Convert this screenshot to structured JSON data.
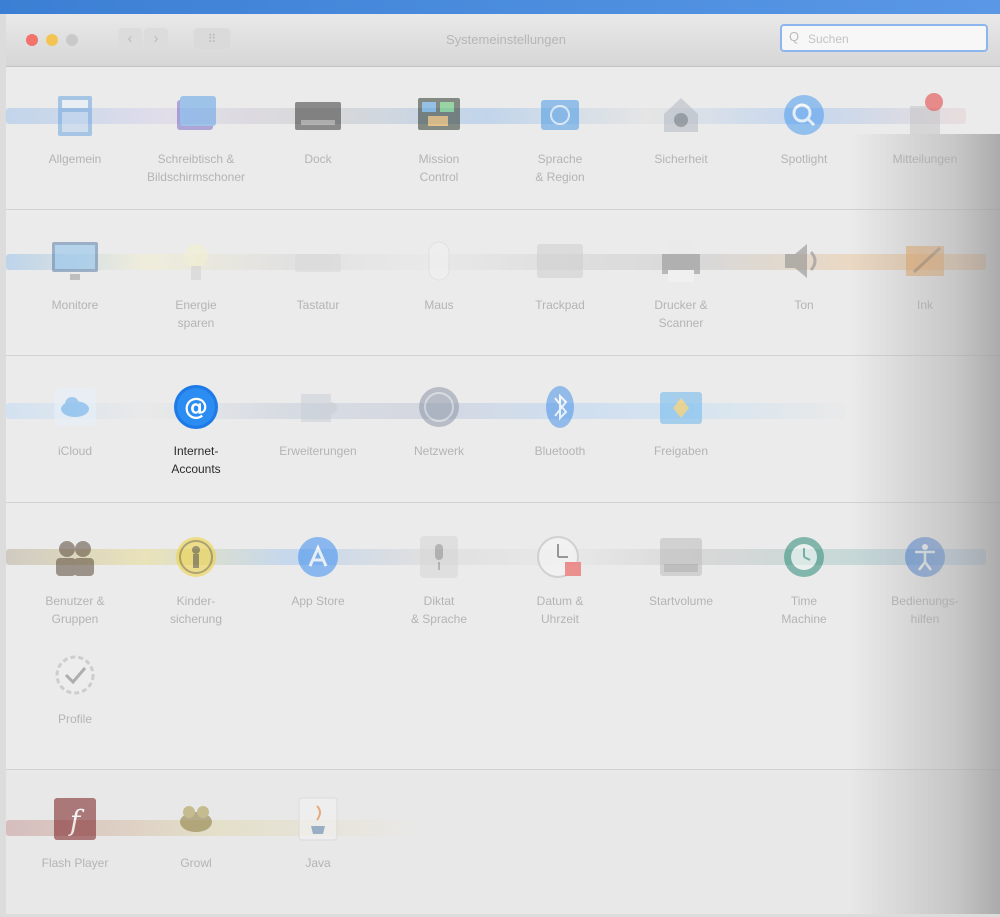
{
  "window": {
    "title": "Systemeinstellungen",
    "search_placeholder": "Suchen",
    "search_glyph": "Q",
    "nav_back_glyph": "‹",
    "nav_forward_glyph": "›",
    "grid_glyph": "⠿"
  },
  "rows": [
    {
      "items": [
        {
          "label": "Allgemein",
          "icon": "general-icon"
        },
        {
          "label": "Schreibtisch &\nBildschirmschoner",
          "icon": "desktop-screensaver-icon"
        },
        {
          "label": "Dock",
          "icon": "dock-icon"
        },
        {
          "label": "Mission\nControl",
          "icon": "mission-control-icon"
        },
        {
          "label": "Sprache\n& Region",
          "icon": "language-region-icon"
        },
        {
          "label": "Sicherheit",
          "icon": "security-icon"
        },
        {
          "label": "Spotlight",
          "icon": "spotlight-icon"
        },
        {
          "label": "Mitteilungen",
          "icon": "notifications-icon"
        }
      ]
    },
    {
      "items": [
        {
          "label": "Monitore",
          "icon": "displays-icon"
        },
        {
          "label": "Energie\nsparen",
          "icon": "energy-saver-icon"
        },
        {
          "label": "Tastatur",
          "icon": "keyboard-icon"
        },
        {
          "label": "Maus",
          "icon": "mouse-icon"
        },
        {
          "label": "Trackpad",
          "icon": "trackpad-icon"
        },
        {
          "label": "Drucker &\nScanner",
          "icon": "printer-scanner-icon"
        },
        {
          "label": "Ton",
          "icon": "sound-icon"
        },
        {
          "label": "Ink",
          "icon": "ink-icon"
        }
      ]
    },
    {
      "items": [
        {
          "label": "iCloud",
          "icon": "icloud-icon"
        },
        {
          "label": "Internet-\nAccounts",
          "icon": "internet-accounts-icon",
          "sharp": true
        },
        {
          "label": "Erweiterungen",
          "icon": "extensions-icon"
        },
        {
          "label": "Netzwerk",
          "icon": "network-icon"
        },
        {
          "label": "Bluetooth",
          "icon": "bluetooth-icon"
        },
        {
          "label": "Freigaben",
          "icon": "sharing-icon"
        }
      ]
    },
    {
      "items": [
        {
          "label": "Benutzer &\nGruppen",
          "icon": "users-groups-icon"
        },
        {
          "label": "Kinder-\nsicherung",
          "icon": "parental-controls-icon"
        },
        {
          "label": "App Store",
          "icon": "app-store-icon"
        },
        {
          "label": "Diktat\n& Sprache",
          "icon": "dictation-speech-icon"
        },
        {
          "label": "Datum &\nUhrzeit",
          "icon": "date-time-icon"
        },
        {
          "label": "Startvolume",
          "icon": "startup-disk-icon"
        },
        {
          "label": "Time\nMachine",
          "icon": "time-machine-icon"
        },
        {
          "label": "Bedienungs-\nhilfen",
          "icon": "accessibility-icon"
        }
      ]
    },
    {
      "items": [
        {
          "label": "Profile",
          "icon": "profiles-icon"
        }
      ]
    },
    {
      "items": [
        {
          "label": "Flash Player",
          "icon": "flash-player-icon"
        },
        {
          "label": "Growl",
          "icon": "growl-icon"
        },
        {
          "label": "Java",
          "icon": "java-icon"
        }
      ]
    }
  ]
}
